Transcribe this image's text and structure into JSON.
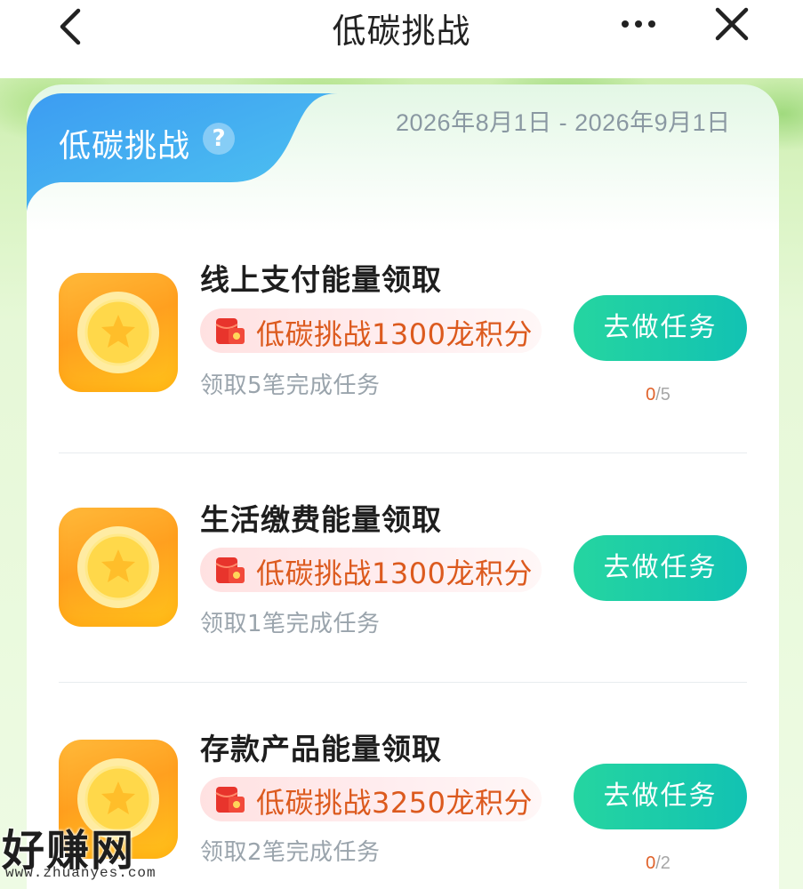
{
  "nav": {
    "title": "低碳挑战",
    "back_icon": "chevron-left-icon",
    "more_icon": "more-dots-icon",
    "close_icon": "close-icon"
  },
  "card": {
    "title": "低碳挑战",
    "help_label": "?",
    "date_range": "2026年8月1日 - 2026年9月1日"
  },
  "tasks": [
    {
      "title": "线上支付能量领取",
      "reward": "低碳挑战1300龙积分",
      "desc": "领取5笔完成任务",
      "button": "去做任务",
      "progress_done": "0",
      "progress_total": "/5"
    },
    {
      "title": "生活缴费能量领取",
      "reward": "低碳挑战1300龙积分",
      "desc": "领取1笔完成任务",
      "button": "去做任务"
    },
    {
      "title": "存款产品能量领取",
      "reward": "低碳挑战3250龙积分",
      "desc": "领取2笔完成任务",
      "button": "去做任务",
      "progress_done": "0",
      "progress_total": "/2"
    }
  ],
  "watermark": {
    "logo": "好赚网",
    "url": "www.zhuanyes.com"
  },
  "colors": {
    "button_start": "#25d5a0",
    "button_end": "#12c2b3",
    "reward_text": "#dc5a1e",
    "tab_blue": "#3aa6f0",
    "icon_orange": "#ffa01f"
  }
}
